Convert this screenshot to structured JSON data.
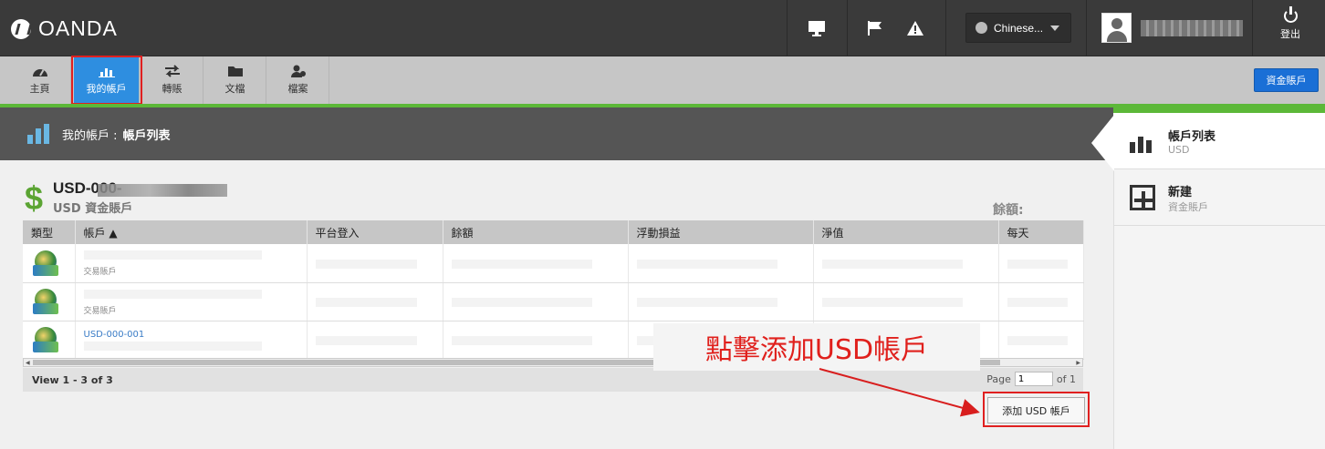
{
  "brand": {
    "name": "OANDA"
  },
  "topbar": {
    "language": "Chinese...",
    "user_name": "",
    "logout_label": "登出",
    "icons": [
      "monitor-icon",
      "flag-icon",
      "warning-icon"
    ]
  },
  "nav": {
    "items": [
      {
        "label": "主頁",
        "icon": "dashboard-icon"
      },
      {
        "label": "我的帳戶",
        "icon": "bar-chart-icon",
        "active": true
      },
      {
        "label": "轉賬",
        "icon": "transfer-icon"
      },
      {
        "label": "文檔",
        "icon": "folder-icon"
      },
      {
        "label": "檔案",
        "icon": "profile-icon"
      }
    ],
    "fund_button": "資金賬戶"
  },
  "section": {
    "prefix": "我的帳戶 :",
    "title": "帳戶列表"
  },
  "account": {
    "currency_symbol": "$",
    "title": "USD-000-",
    "subtitle": "USD 資金賬戶",
    "balance_label": "餘額:"
  },
  "table": {
    "columns": [
      "類型",
      "帳戶 ▲",
      "平台登入",
      "餘額",
      "浮動損益",
      "淨值",
      "每天"
    ],
    "rows": [
      {
        "name": "交易賬戶",
        "link": ""
      },
      {
        "name": "交易賬戶",
        "link": ""
      },
      {
        "name": "",
        "link": "USD-000-001"
      }
    ]
  },
  "pager": {
    "view": "View 1 - 3 of 3",
    "page_label": "Page",
    "page_value": "1",
    "of_label": "of 1"
  },
  "callout": "點擊添加USD帳戶",
  "add_button": "添加 USD 帳戶",
  "right_panel": {
    "list": {
      "title": "帳戶列表",
      "sub": "USD"
    },
    "new": {
      "title": "新建",
      "sub": "資金賬戶"
    }
  },
  "colors": {
    "accent_green": "#5cb838",
    "nav_active": "#2e8ee0",
    "highlight_red": "#e02020",
    "fund_blue": "#1a6fd6"
  }
}
